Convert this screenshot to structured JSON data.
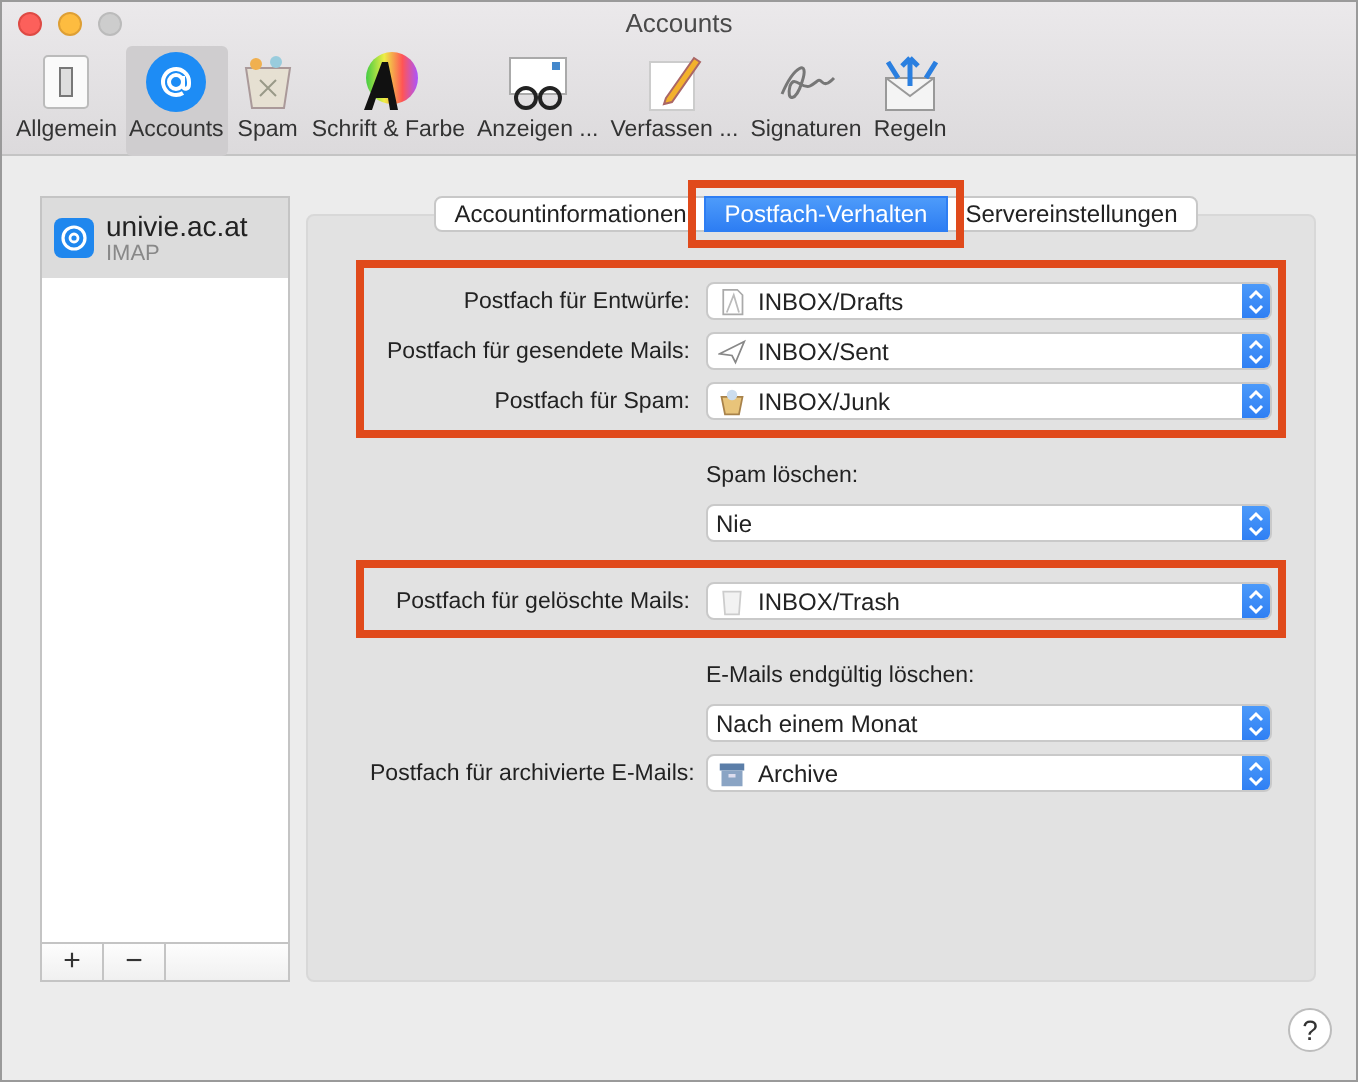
{
  "window": {
    "title": "Accounts"
  },
  "toolbar": [
    {
      "label": "Allgemein",
      "selected": false
    },
    {
      "label": "Accounts",
      "selected": true
    },
    {
      "label": "Spam",
      "selected": false
    },
    {
      "label": "Schrift & Farbe",
      "selected": false
    },
    {
      "label": "Anzeigen ...",
      "selected": false
    },
    {
      "label": "Verfassen ...",
      "selected": false
    },
    {
      "label": "Signaturen",
      "selected": false
    },
    {
      "label": "Regeln",
      "selected": false
    }
  ],
  "accounts": [
    {
      "name": "univie.ac.at",
      "type": "IMAP",
      "selected": true
    }
  ],
  "account_buttons": [
    "+",
    "−"
  ],
  "tabs": [
    {
      "label": "Accountinformationen",
      "selected": false,
      "highlighted": false
    },
    {
      "label": "Postfach-Verhalten",
      "selected": true,
      "highlighted": true
    },
    {
      "label": "Servereinstellungen",
      "selected": false,
      "highlighted": false
    }
  ],
  "sections": [
    {
      "highlighted": true,
      "rows": [
        {
          "kind": "drafts",
          "label": "Postfach für Entwürfe:",
          "value": "INBOX/Drafts"
        },
        {
          "kind": "sent",
          "label": "Postfach für gesendete Mails:",
          "value": "INBOX/Sent"
        },
        {
          "kind": "junk",
          "label": "Postfach für Spam:",
          "value": "INBOX/Junk"
        }
      ]
    },
    {
      "highlighted": false,
      "rows": [
        {
          "kind": "caption",
          "text": "Spam löschen:"
        },
        {
          "kind": "popup",
          "value": "Nie"
        }
      ]
    },
    {
      "highlighted": true,
      "rows": [
        {
          "kind": "trash",
          "label": "Postfach für gelöschte Mails:",
          "value": "INBOX/Trash"
        }
      ]
    },
    {
      "highlighted": false,
      "rows": [
        {
          "kind": "caption",
          "text": "E-Mails endgültig löschen:"
        },
        {
          "kind": "popup",
          "value": "Nach einem Monat"
        },
        {
          "kind": "archive",
          "label": "Postfach für archivierte E-Mails:",
          "value": "Archive"
        }
      ]
    }
  ],
  "help": "?"
}
